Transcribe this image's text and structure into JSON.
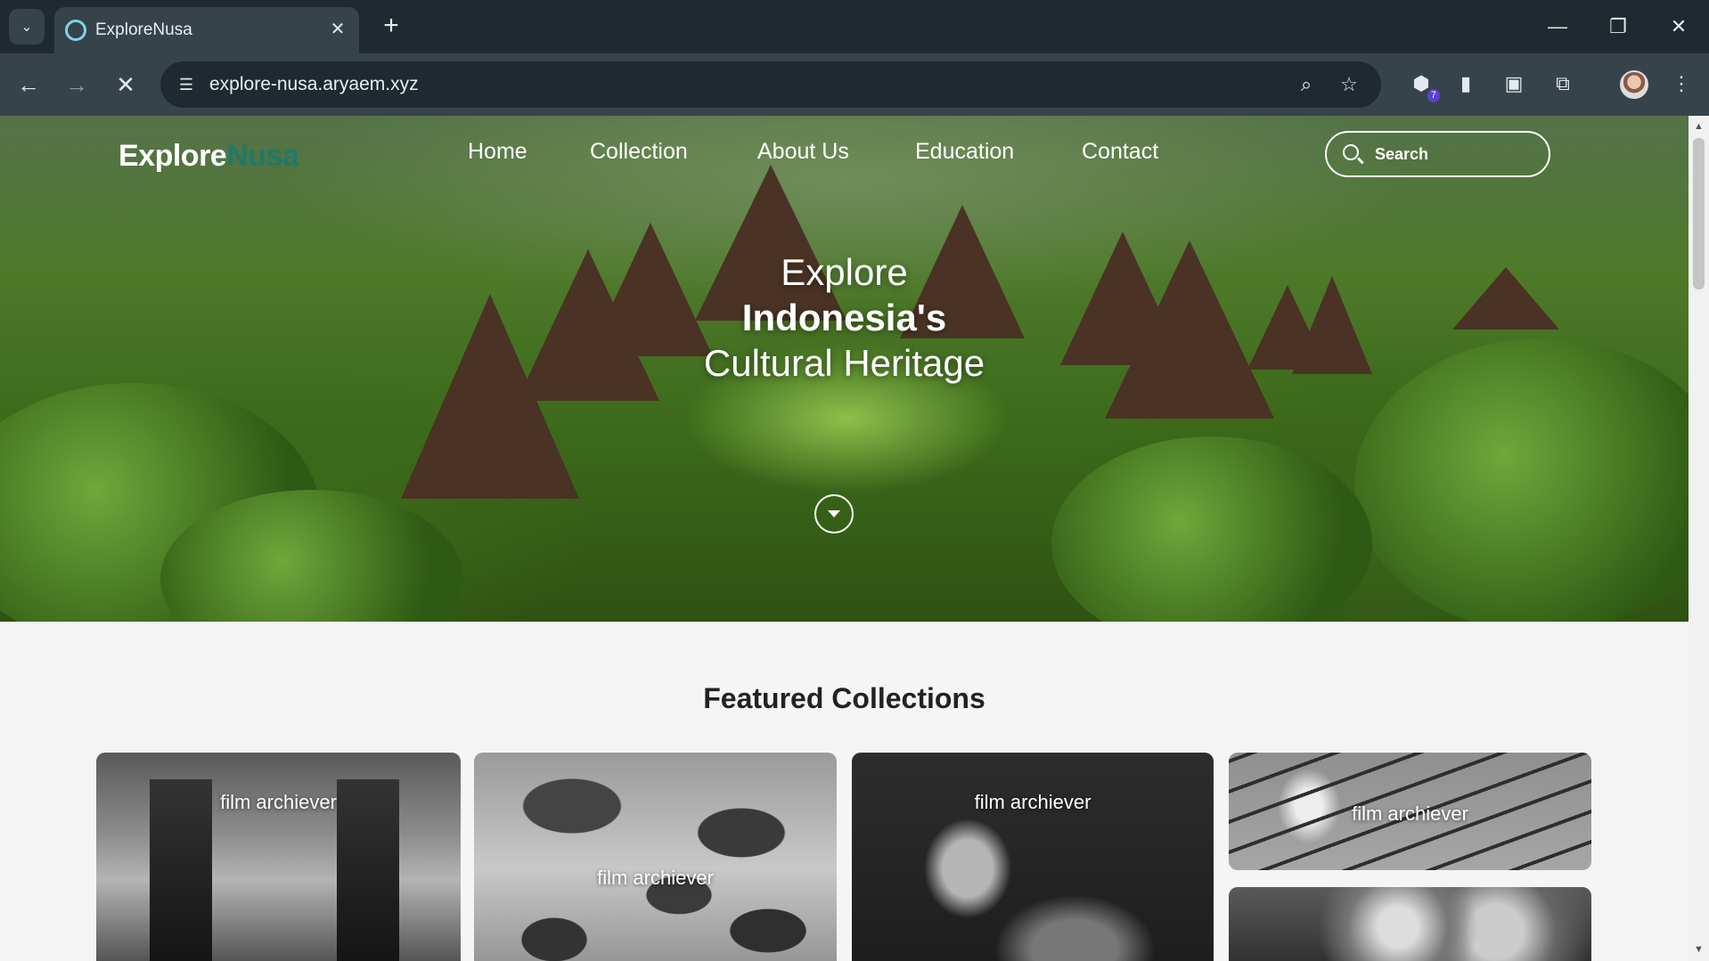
{
  "browser": {
    "tab_title": "ExploreNusa",
    "url": "explore-nusa.aryaem.xyz",
    "extension_badge": "7"
  },
  "site": {
    "logo_part1": "Explore",
    "logo_part2": "Nusa",
    "nav": [
      "Home",
      "Collection",
      "About Us",
      "Education",
      "Contact"
    ],
    "search_placeholder": "Search"
  },
  "hero": {
    "line1": "Explore",
    "line2": "Indonesia's",
    "line3": "Cultural Heritage"
  },
  "featured": {
    "title": "Featured Collections",
    "cards": [
      {
        "label": "film archiever"
      },
      {
        "label": "film archiever"
      },
      {
        "label": "film archiever"
      },
      {
        "label": "film archiever"
      }
    ]
  }
}
